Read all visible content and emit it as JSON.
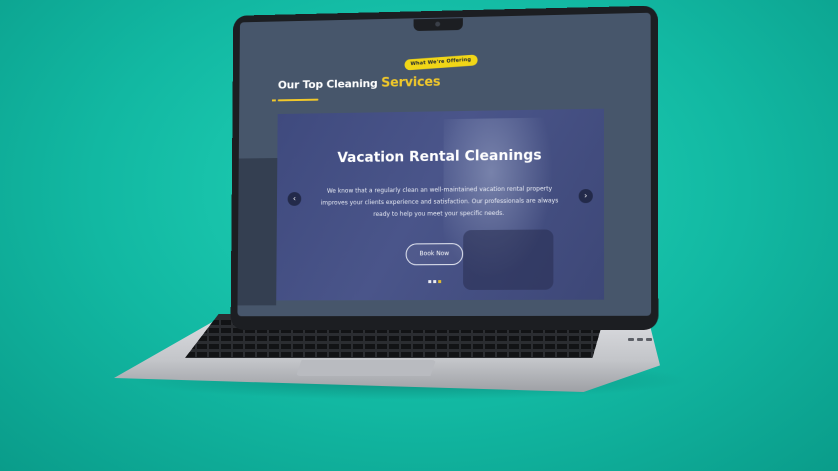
{
  "badge": "What We're Offering",
  "section": {
    "title_prefix": "Our Top Cleaning",
    "title_accent": "Services"
  },
  "slide": {
    "heading": "Vacation Rental Cleanings",
    "body": "We know that a regularly clean an well-maintained vacation rental property improves your clients experience and satisfaction. Our professionals are always ready to help you meet your specific needs.",
    "button": "Book Now",
    "prev_icon": "‹",
    "next_icon": "›",
    "dots_count": 3,
    "active_dot": 3
  },
  "colors": {
    "background": "#12b8a2",
    "accent": "#f1c82a",
    "screen_bg": "#47566b",
    "slide_overlay": "#4a558a"
  }
}
